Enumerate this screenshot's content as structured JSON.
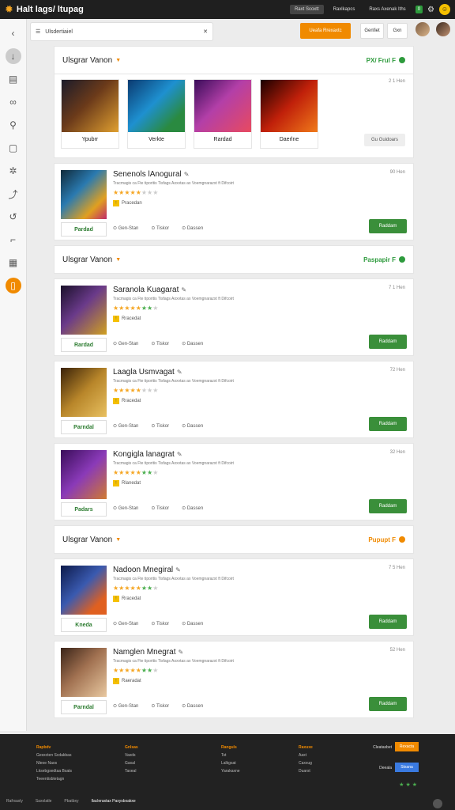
{
  "header": {
    "app_name": "Halt lags/ ltupag",
    "nav": [
      "Raxt Scoxtt",
      "Raxlkapcs",
      "Raxs Axenak Iths"
    ],
    "badge": "0"
  },
  "search": {
    "value": "Ulsdertiaiel"
  },
  "toolbar": {
    "primary": "Ueafa Rrexaxtc",
    "btn_a": "Genfiet",
    "btn_b": "Gxn"
  },
  "sections": [
    {
      "title": "Ulsgrar Vanon",
      "status": "PX/ Frul F",
      "status_color": "#2e9b3d",
      "featured": {
        "items": [
          {
            "caption": "Ypubrr",
            "art": "linear-gradient(135deg,#1b1b2a,#6b3a1a 45%,#e0a030)"
          },
          {
            "caption": "Verkte",
            "art": "linear-gradient(135deg,#0b3a70,#1e90d0 45%,#2a8a40 80%)"
          },
          {
            "caption": "Rardad",
            "art": "linear-gradient(135deg,#3a0d5a,#b33fa8 45%,#e84a5f)"
          },
          {
            "caption": "Daerlne",
            "art": "linear-gradient(135deg,#1a0000,#c0200a 50%,#f07a1a)"
          }
        ],
        "meta": "2 1 Hen",
        "more": "Gu Guidoars"
      },
      "cards": [
        {
          "title": "Senenols lAnogural",
          "time": "90 Hen",
          "sub": "Pracedan",
          "label": "Pardad",
          "action": "Raddam",
          "stars": [
            "or",
            "or",
            "or",
            "or",
            "or",
            "gy",
            "gy",
            "gy"
          ],
          "art": "linear-gradient(135deg,#102a3a,#2a7ab0 40%,#e0a020 75%,#c02a6a)"
        }
      ]
    },
    {
      "title": "Ulsgrar Vanon",
      "status": "Paspapir F",
      "status_color": "#2e9b3d",
      "cards": [
        {
          "title": "Saranola Kuagarat",
          "time": "7 1 Hen",
          "sub": "Rracedat",
          "label": "Rardad",
          "action": "Raddam",
          "stars": [
            "or",
            "or",
            "or",
            "or",
            "or",
            "gr",
            "gr",
            "gy"
          ],
          "art": "linear-gradient(135deg,#1a102a,#6a3a8a 45%,#d0a020)"
        },
        {
          "title": "Laagla Usmvagat",
          "time": "72 Hen",
          "sub": "Rracedat",
          "label": "Parndal",
          "action": "Raddam",
          "stars": [
            "or",
            "or",
            "or",
            "or",
            "or",
            "gy",
            "gy",
            "gy"
          ],
          "art": "linear-gradient(135deg,#3a2208,#b8862a 50%,#e8c060)"
        },
        {
          "title": "Kongigla lanagrat",
          "time": "32 Hen",
          "sub": "Rlanedat",
          "label": "Padars",
          "action": "Raddam",
          "stars": [
            "or",
            "or",
            "or",
            "or",
            "or",
            "gr",
            "gr",
            "gy"
          ],
          "art": "linear-gradient(135deg,#3a0d5a,#8a3ab8 50%,#d07a30)"
        }
      ]
    },
    {
      "title": "Ulsgrar Vanon",
      "status": "Pupupt F",
      "status_color": "#f08a00",
      "cards": [
        {
          "title": "Nadoon Mnegiral",
          "time": "7 5 Hen",
          "sub": "Rracedat",
          "label": "Kneda",
          "action": "Raddam",
          "stars": [
            "or",
            "or",
            "or",
            "or",
            "or",
            "gr",
            "gr",
            "gy"
          ],
          "art": "linear-gradient(135deg,#0d1a4a,#3a5ab0 45%,#e06020 80%)"
        },
        {
          "title": "Namglen Mnegrat",
          "time": "52 Hen",
          "sub": "Raeradat",
          "label": "Parndal",
          "action": "Raddam",
          "stars": [
            "or",
            "or",
            "or",
            "or",
            "or",
            "gr",
            "gr",
            "gy"
          ],
          "art": "linear-gradient(135deg,#3a2418,#a07050 45%,#e8c8a0)"
        }
      ]
    }
  ],
  "card_desc": "Tracmagis ca Fte tiporitis Tisfags Aoxvtas ax Voemgnarazxt ft Difcoirt",
  "card_foot": [
    "Gen-Stan",
    "Tiskor",
    "Dassen"
  ],
  "footer": {
    "cols": [
      {
        "head": "Rapbdv",
        "lines": [
          "Gesxcten Scdakbas",
          "Nleoe Naos",
          "Lksebgsedtaa Bsats",
          "Teeentisbtetagn"
        ]
      },
      {
        "head": "Gnlsas",
        "lines": [
          "Vaxds",
          "Gaxal",
          "Taxeal"
        ]
      },
      {
        "head": "Ranguls",
        "lines": [
          "Tst",
          "Lalkgsat",
          "Yarakaxne"
        ]
      },
      {
        "head": "Raxuxe",
        "lines": [
          "Aaxt",
          "Caxxug",
          "Duarst"
        ]
      }
    ],
    "cta1_label": "Cleatasbet",
    "cta1_btn": "Rexacta",
    "cta2_label": "Deeala",
    "cta2_btn": "Stxana",
    "bottom": [
      "Rafrsaxly",
      "Saxolatle",
      "Pbatbxy",
      "Ilacleraxtax Paxysbxakxe"
    ]
  }
}
